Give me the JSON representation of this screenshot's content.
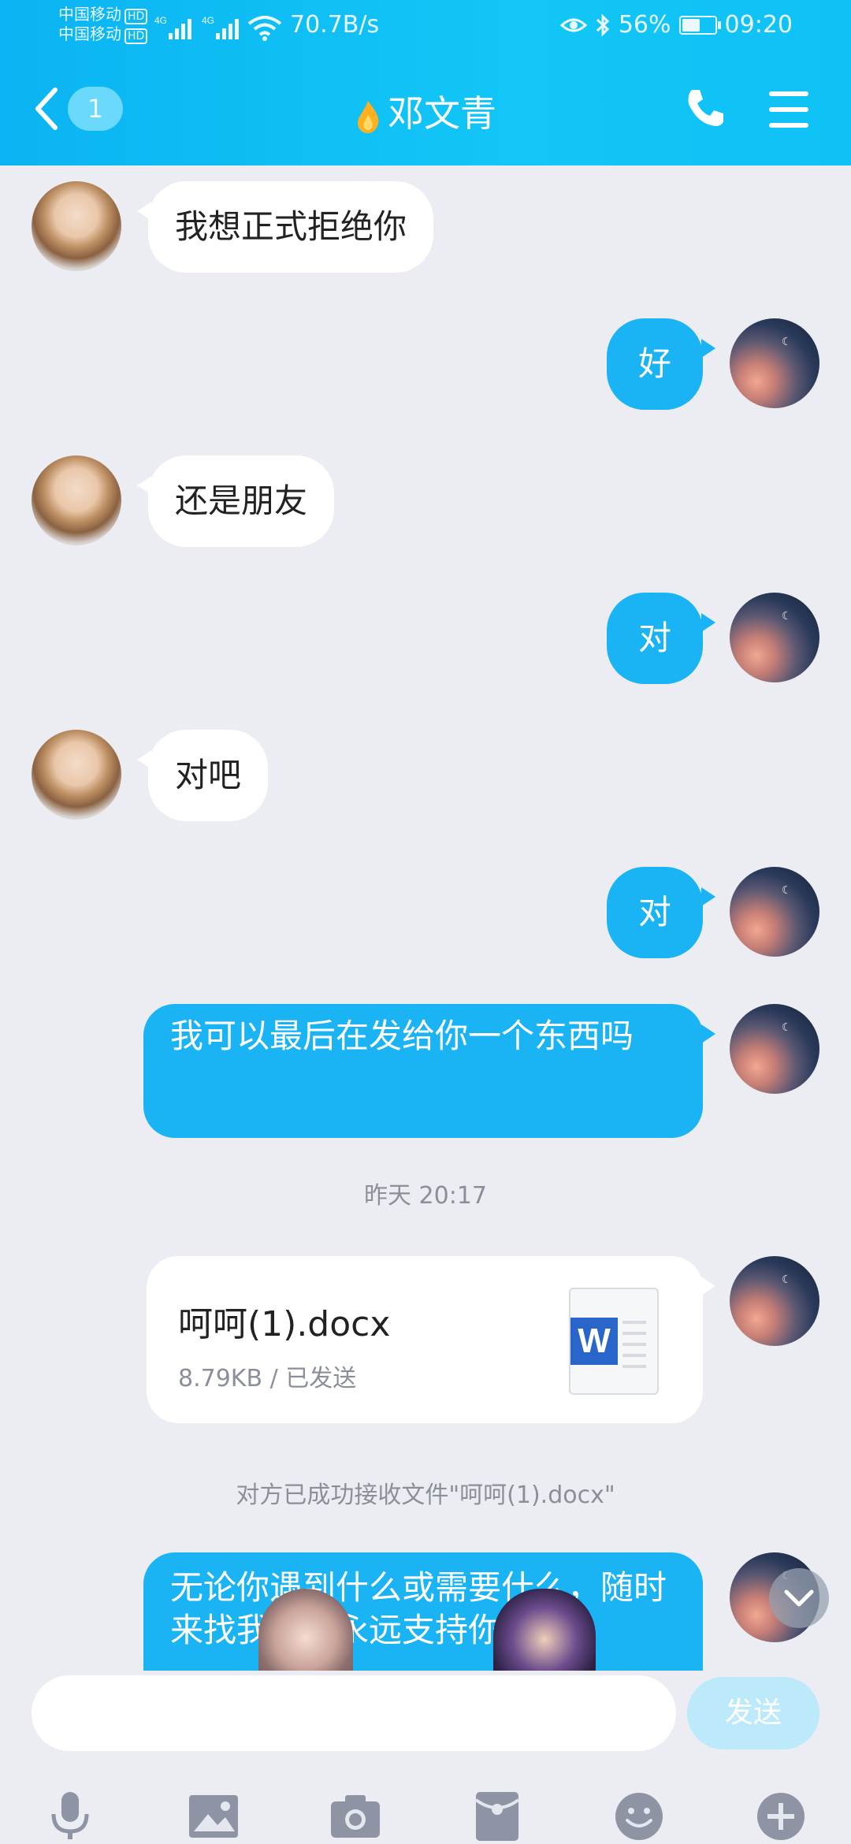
{
  "status_bar": {
    "carrier1": "中国移动",
    "carrier2": "中国移动",
    "hd": "HD",
    "net_speed": "70.7B/s",
    "battery": "56%",
    "battery_level": 0.56,
    "time": "09:20"
  },
  "header": {
    "unread_count": "1",
    "contact_name": "邓文青"
  },
  "messages": [
    {
      "side": "left",
      "text": "我想正式拒绝你"
    },
    {
      "side": "right",
      "text": "好"
    },
    {
      "side": "left",
      "text": "还是朋友"
    },
    {
      "side": "right",
      "text": "对"
    },
    {
      "side": "left",
      "text": "对吧"
    },
    {
      "side": "right",
      "text": "对"
    },
    {
      "side": "right",
      "text": "我可以最后在发给你一个东西吗"
    },
    {
      "side": "right",
      "text": "无论你遇到什么或需要什么，随时来找我，我永远支持你"
    }
  ],
  "timestamp": "昨天 20:17",
  "file": {
    "name": "呵呵(1).docx",
    "meta": "8.79KB / 已发送"
  },
  "notice": "对方已成功接收文件\"呵呵(1).docx\"",
  "input": {
    "value": "",
    "send_label": "发送"
  },
  "toolbar": [
    "mic-icon",
    "image-icon",
    "camera-icon",
    "red-packet-icon",
    "emoji-icon",
    "plus-icon"
  ],
  "colors": {
    "header": "#12c6f7",
    "bubble_right": "#1ab3f4",
    "bubble_left": "#ffffff",
    "background": "#ebedf3"
  }
}
